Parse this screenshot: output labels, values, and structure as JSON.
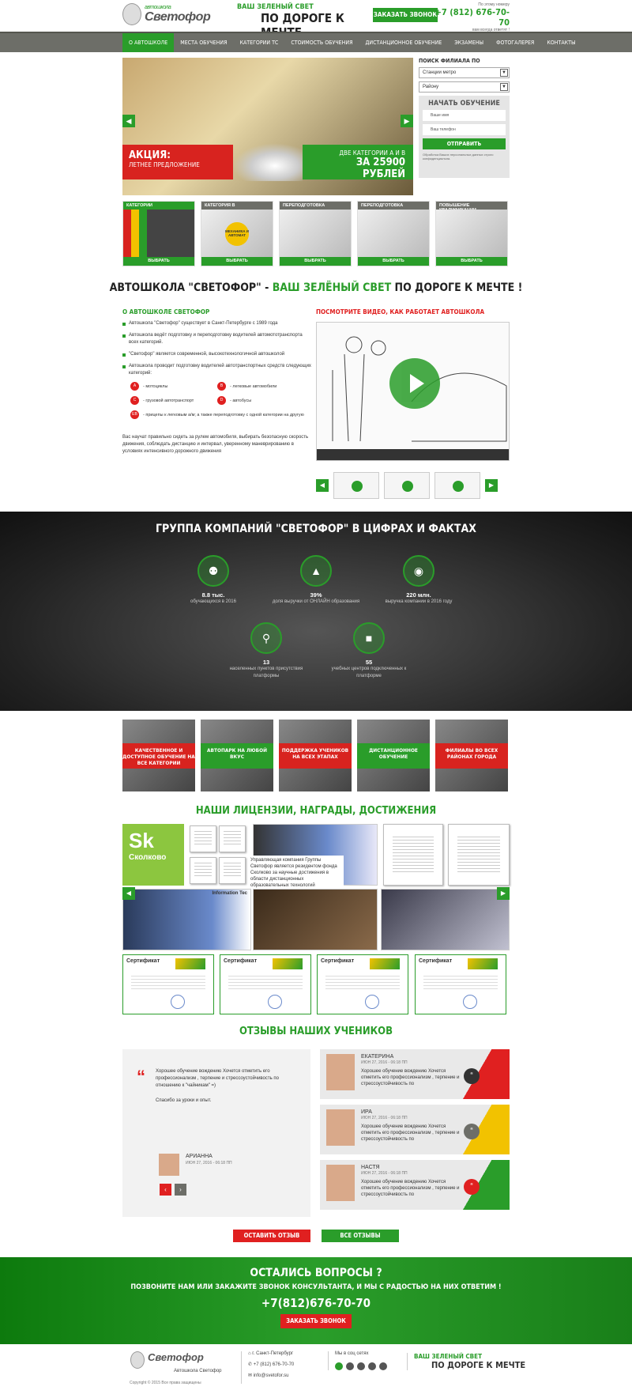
{
  "header": {
    "logo_small": "автошкола",
    "logo_big": "Светофор",
    "slogan_top": "ВАШ ЗЕЛЕНЫЙ СВЕТ",
    "slogan_bottom": "ПО ДОРОГЕ К МЕЧТЕ",
    "call_button": "ЗАКАЗАТЬ ЗВОНОК",
    "phone_caption": "По этому номеру",
    "phone": "+7 (812) 676-70-70",
    "phone_note": "вам всегда ответят !"
  },
  "nav": [
    "О АВТОШКОЛЕ",
    "МЕСТА ОБУЧЕНИЯ",
    "КАТЕГОРИИ ТС",
    "СТОИМОСТЬ ОБУЧЕНИЯ",
    "ДИСТАНЦИОННОЕ ОБУЧЕНИЕ",
    "ЭКЗАМЕНЫ",
    "ФОТОГАЛЕРЕЯ",
    "КОНТАКТЫ"
  ],
  "hero": {
    "promo_title": "АКЦИЯ:",
    "promo_sub": "ЛЕТНЕЕ ПРЕДЛОЖЕНИЕ",
    "offer_sub": "ДВЕ КАТЕГОРИИ А И В",
    "offer_price": "ЗА 25900 РУБЛЕЙ"
  },
  "branch": {
    "title": "ПОИСК ФИЛИАЛА ПО",
    "select1": "Станции метро",
    "select2": "Району",
    "form_title": "НАЧАТЬ ОБУЧЕНИЕ",
    "name_ph": "Ваше имя",
    "phone_ph": "Ваш телефон",
    "send": "ОТПРАВИТЬ",
    "note": "Обработка Ваших персональных данных строго конфиденциальна."
  },
  "cats": [
    {
      "title": "КАТЕГОРИИ",
      "btn": "ВЫБРАТЬ"
    },
    {
      "title": "КАТЕГОРИЯ В",
      "btn": "ВЫБРАТЬ"
    },
    {
      "title": "ПЕРЕПОДГОТОВКА",
      "btn": "ВЫБРАТЬ"
    },
    {
      "title": "ПЕРЕПОДГОТОВКА",
      "btn": "ВЫБРАТЬ"
    },
    {
      "title": "ПОВЫШЕНИЕ КВАЛИФИКАЦИИ",
      "btn": "ВЫБРАТЬ"
    }
  ],
  "cat_badge": "МЕХАНИКА И АВТОМАТ",
  "title1_a": "АВТОШКОЛА \"СВЕТОФОР\" - ",
  "title1_b": "ВАШ ЗЕЛЁНЫЙ СВЕТ",
  "title1_c": " ПО ДОРОГЕ К МЕЧТЕ !",
  "about": {
    "title": "О АВТОШКОЛЕ СВЕТОФОР",
    "items": [
      "Автошкола \"Светофор\" существует в Санкт-Петербурге с 1989 года",
      "Автошкола ведёт подготовку и переподготовку водителей автомототранспорта всех категорий.",
      "\"Светофор\" является современной, высокотехнологичной автошколой",
      "Автошкола проводит подготовку водителей автотранспортных средств следующих категорий:"
    ],
    "categories": [
      {
        "code": "A",
        "text": "- мотоциклы"
      },
      {
        "code": "B",
        "text": "- легковые автомобили"
      },
      {
        "code": "C",
        "text": "- грузовой автотранспорт"
      },
      {
        "code": "D",
        "text": "- автобусы"
      },
      {
        "code": "EB",
        "text": "- прицепы к легковым а/м; а также переподготовку с одной категории на другую"
      }
    ],
    "paragraph": "Вас научат правильно сидеть за рулем автомобиля, выбирать безопасную скорость движения, соблюдать дистанцию и интервал, уверенному маневрированию в условиях интенсивного дорожного движения"
  },
  "video": {
    "title": "ПОСМОТРИТЕ ВИДЕО, КАК РАБОТАЕТ АВТОШКОЛА"
  },
  "stats": {
    "title": "ГРУППА КОМПАНИЙ \"СВЕТОФОР\" В ЦИФРАХ И ФАКТАХ",
    "items": [
      {
        "value": "8.8 тыс.",
        "desc": "обучающихся в 2016"
      },
      {
        "value": "39%",
        "desc": "доля выручки от ОНЛАЙН образования"
      },
      {
        "value": "220 млн.",
        "desc": "выручка компании в 2016 году"
      },
      {
        "value": "13",
        "desc": "населенных пунктов присутствия платформы"
      },
      {
        "value": "55",
        "desc": "учебных центров подключенных к платформе"
      }
    ]
  },
  "features": [
    {
      "text": "КАЧЕСТВЕННОЕ И ДОСТУПНОЕ ОБУЧЕНИЕ НА ВСЕ КАТЕГОРИИ",
      "color": "#d8231f"
    },
    {
      "text": "АВТОПАРК НА ЛЮБОЙ ВКУС",
      "color": "#2a9d2a"
    },
    {
      "text": "ПОДДЕРЖКА УЧЕНИКОВ НА ВСЕХ ЭТАПАХ",
      "color": "#d8231f"
    },
    {
      "text": "ДИСТАНЦИОННОЕ ОБУЧЕНИЕ",
      "color": "#2a9d2a"
    },
    {
      "text": "ФИЛИАЛЫ ВО ВСЕХ РАЙОНАХ ГОРОДА",
      "color": "#d8231f"
    }
  ],
  "licenses": {
    "title": "НАШИ ЛИЦЕНЗИИ, НАГРАДЫ, ДОСТИЖЕНИЯ",
    "sk_big": "Sk",
    "sk_small": "Сколково",
    "caption": "Управляющая компания Группы Светофор является резидентом фонда Сколково за научные достижения в области дистанционных образовательных технологий",
    "photo_label": "Information Tec",
    "cert_title": "Сертификат"
  },
  "reviews": {
    "title": "ОТЗЫВЫ НАШИХ УЧЕНИКОВ",
    "main": {
      "text": "Хорошее обучение вождению Хочется отметить его профессионализм , терпение и стрессоустойчивость по отношению к \"чайникам\" =)",
      "text2": "Спасибо за уроки и опыт.",
      "name": "АРИАННА",
      "date": "ИЮН 27, 2016 - 06:18 ПП"
    },
    "items": [
      {
        "name": "ЕКАТЕРИНА",
        "date": "ИЮН 27, 2016 - 06:18 ПП",
        "text": "Хорошее обучение вождению Хочется отметить его профессионализм , терпение и стрессоустойчивость по",
        "color": "#e02020"
      },
      {
        "name": "ИРА",
        "date": "ИЮН 27, 2016 - 06:18 ПП",
        "text": "Хорошее обучение вождению Хочется отметить его профессионализм , терпение и стрессоустойчивость по",
        "color": "#f2c200"
      },
      {
        "name": "НАСТЯ",
        "date": "ИЮН 27, 2016 - 06:18 ПП",
        "text": "Хорошее обучение вождению Хочется отметить его профессионализм , терпение и стрессоустойчивость по",
        "color": "#2a9d2a"
      }
    ],
    "leave": "ОСТАВИТЬ ОТЗЫВ",
    "all": "ВСЕ ОТЗЫВЫ"
  },
  "callout": {
    "title": "ОСТАЛИСЬ ВОПРОСЫ ?",
    "sub": "ПОЗВОНИТЕ НАМ ИЛИ ЗАКАЖИТЕ ЗВОНОК КОНСУЛЬТАНТА, И МЫ С РАДОСТЬЮ НА НИХ ОТВЕТИМ !",
    "phone": "+7(812)676-70-70",
    "btn": "ЗАКАЗАТЬ ЗВОНОК"
  },
  "footer": {
    "logo_big": "Светофор",
    "logo_sub": "Автошкола Светофор",
    "copy": "Copyright © 2015 Все права защищены",
    "city": "г. Санкт-Петербург",
    "phone": "+7 (812) 676-70-70",
    "email": "info@svetofor.su",
    "social_title": "Мы в соц сетях",
    "slogan_top": "ВАШ ЗЕЛЕНЫЙ СВЕТ",
    "slogan_bottom": "ПО ДОРОГЕ К МЕЧТЕ"
  }
}
